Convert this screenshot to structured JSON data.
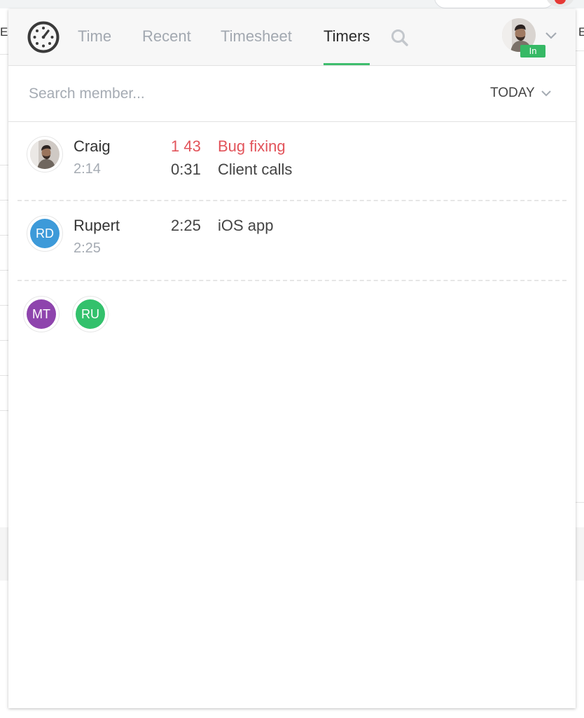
{
  "background": {
    "left_edge_letter": "E",
    "right_edge_letter": "E"
  },
  "header": {
    "logo_icon": "stopwatch-icon",
    "tabs": [
      {
        "label": "Time",
        "active": false
      },
      {
        "label": "Recent",
        "active": false
      },
      {
        "label": "Timesheet",
        "active": false
      },
      {
        "label": "Timers",
        "active": true
      }
    ],
    "search_icon": "search-icon",
    "user": {
      "avatar": "photo",
      "status_badge": "In",
      "menu_icon": "chevron-down-icon"
    }
  },
  "filter": {
    "search_placeholder": "Search member...",
    "search_value": "",
    "period": "TODAY"
  },
  "members": [
    {
      "name": "Craig",
      "avatar": "photo",
      "total": "2:14",
      "timers": [
        {
          "time": "1 43",
          "label": "Bug fixing",
          "running": true
        },
        {
          "time": "0:31",
          "label": "Client calls",
          "running": false
        }
      ]
    },
    {
      "name": "Rupert",
      "initials": "RD",
      "total": "2:25",
      "timers": [
        {
          "time": "2:25",
          "label": "iOS app",
          "running": false
        }
      ]
    }
  ],
  "idle_members": [
    {
      "initials": "MT"
    },
    {
      "initials": "RU"
    }
  ],
  "colors": {
    "accent_green": "#3fbe6e",
    "status_in": "#36b965",
    "running_red": "#e2545b",
    "avatar_rd": "#3d9ad9",
    "avatar_mt": "#8e44ad",
    "avatar_ru": "#33c16c"
  }
}
